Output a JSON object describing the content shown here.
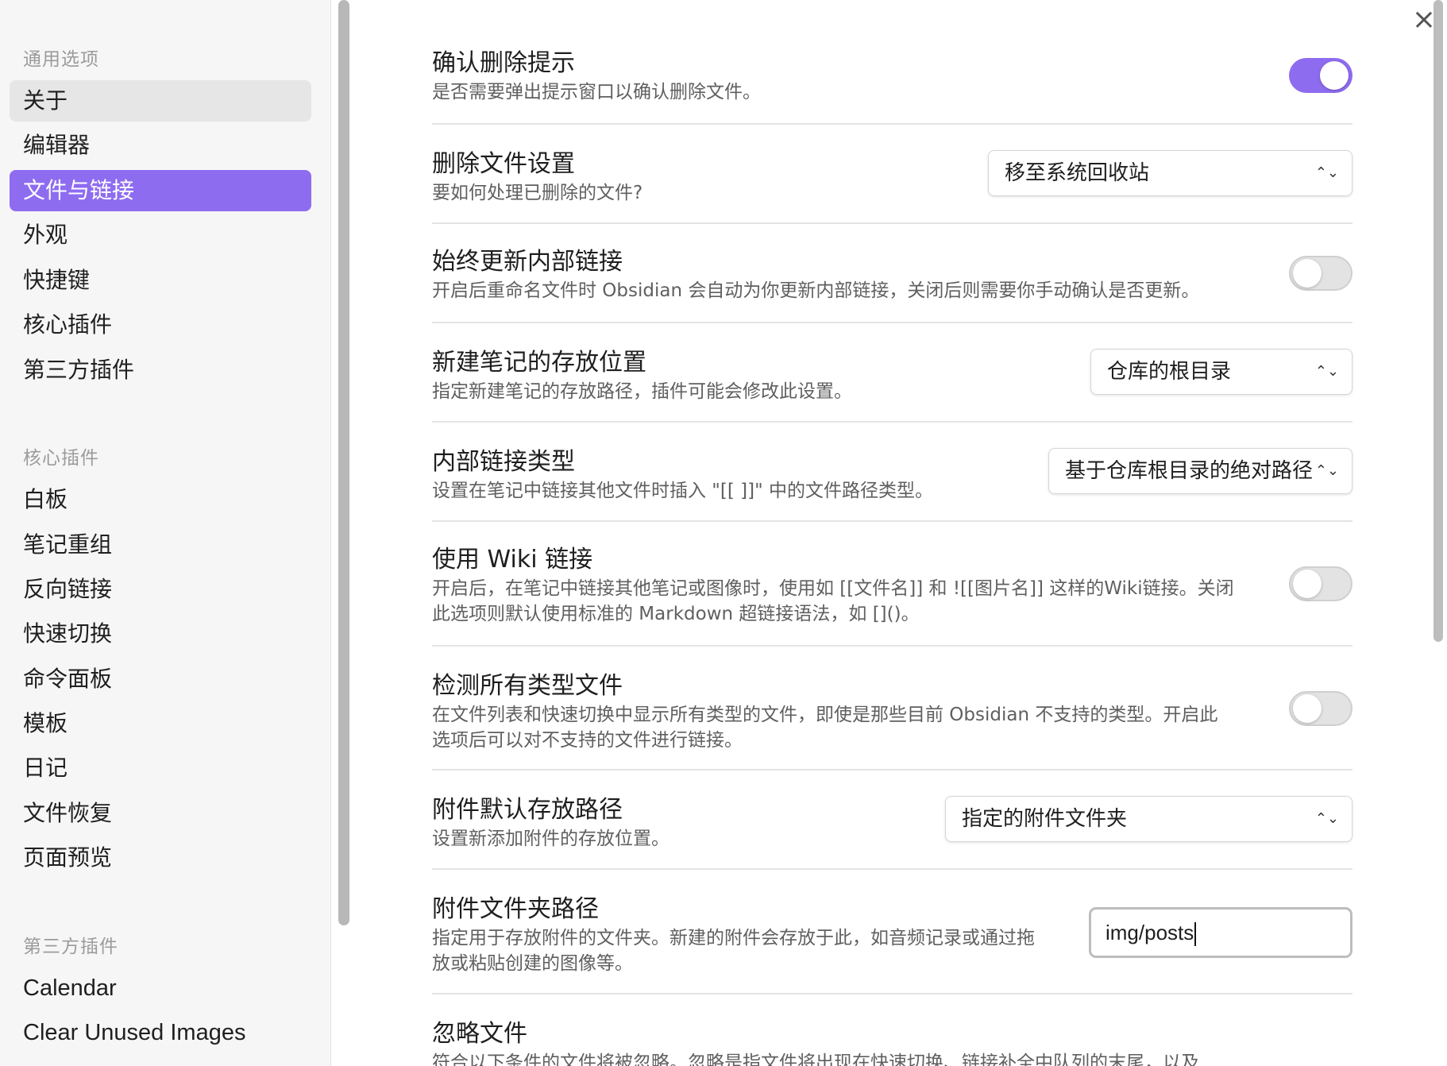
{
  "sidebar": {
    "general_title": "通用选项",
    "general_items": [
      {
        "label": "关于"
      },
      {
        "label": "编辑器"
      },
      {
        "label": "文件与链接"
      },
      {
        "label": "外观"
      },
      {
        "label": "快捷键"
      },
      {
        "label": "核心插件"
      },
      {
        "label": "第三方插件"
      }
    ],
    "core_title": "核心插件",
    "core_items": [
      {
        "label": "白板"
      },
      {
        "label": "笔记重组"
      },
      {
        "label": "反向链接"
      },
      {
        "label": "快速切换"
      },
      {
        "label": "命令面板"
      },
      {
        "label": "模板"
      },
      {
        "label": "日记"
      },
      {
        "label": "文件恢复"
      },
      {
        "label": "页面预览"
      }
    ],
    "third_title": "第三方插件",
    "third_items": [
      {
        "label": "Calendar"
      },
      {
        "label": "Clear Unused Images"
      }
    ],
    "active_item": "文件与链接",
    "hover_item": "关于"
  },
  "close_icon": "×",
  "settings": [
    {
      "name": "确认删除提示",
      "desc": "是否需要弹出提示窗口以确认删除文件。",
      "control": "toggle",
      "state": "on"
    },
    {
      "name": "删除文件设置",
      "desc": "要如何处理已删除的文件?",
      "control": "select",
      "value": "移至系统回收站"
    },
    {
      "name": "始终更新内部链接",
      "desc": "开启后重命名文件时 Obsidian 会自动为你更新内部链接，关闭后则需要你手动确认是否更新。",
      "control": "toggle",
      "state": "off"
    },
    {
      "name": "新建笔记的存放位置",
      "desc": "指定新建笔记的存放路径，插件可能会修改此设置。",
      "control": "select",
      "value": "仓库的根目录"
    },
    {
      "name": "内部链接类型",
      "desc": "设置在笔记中链接其他文件时插入 \"[[ ]]\" 中的文件路径类型。",
      "control": "select",
      "value": "基于仓库根目录的绝对路径"
    },
    {
      "name": "使用 Wiki 链接",
      "desc_line1": "开启后，在笔记中链接其他笔记或图像时，使用如 [[文件名]] 和 ![[图片名]] 这样的Wiki链接。关闭",
      "desc_line2": "此选项则默认使用标准的 Markdown 超链接语法，如 []()。",
      "control": "toggle",
      "state": "off"
    },
    {
      "name": "检测所有类型文件",
      "desc_line1": "在文件列表和快速切换中显示所有类型的文件，即使是那些目前 Obsidian 不支持的类型。开启此",
      "desc_line2": "选项后可以对不支持的文件进行链接。",
      "control": "toggle",
      "state": "off"
    },
    {
      "name": "附件默认存放路径",
      "desc": "设置新添加附件的存放位置。",
      "control": "select",
      "value": "指定的附件文件夹"
    },
    {
      "name": "附件文件夹路径",
      "desc_line1": "指定用于存放附件的文件夹。新建的附件会存放于此，如音频记录或通过拖",
      "desc_line2": "放或粘贴创建的图像等。",
      "control": "text",
      "value": "img/posts"
    },
    {
      "name": "忽略文件",
      "desc": "符合以下条件的文件将被忽略。忽略是指文件将出现在快速切换、链接补全中队列的末尾，以及"
    }
  ],
  "colors": {
    "accent": "#8e6cf0",
    "sidebar_bg": "#f6f6f6",
    "muted_text": "#5f5f5f"
  }
}
